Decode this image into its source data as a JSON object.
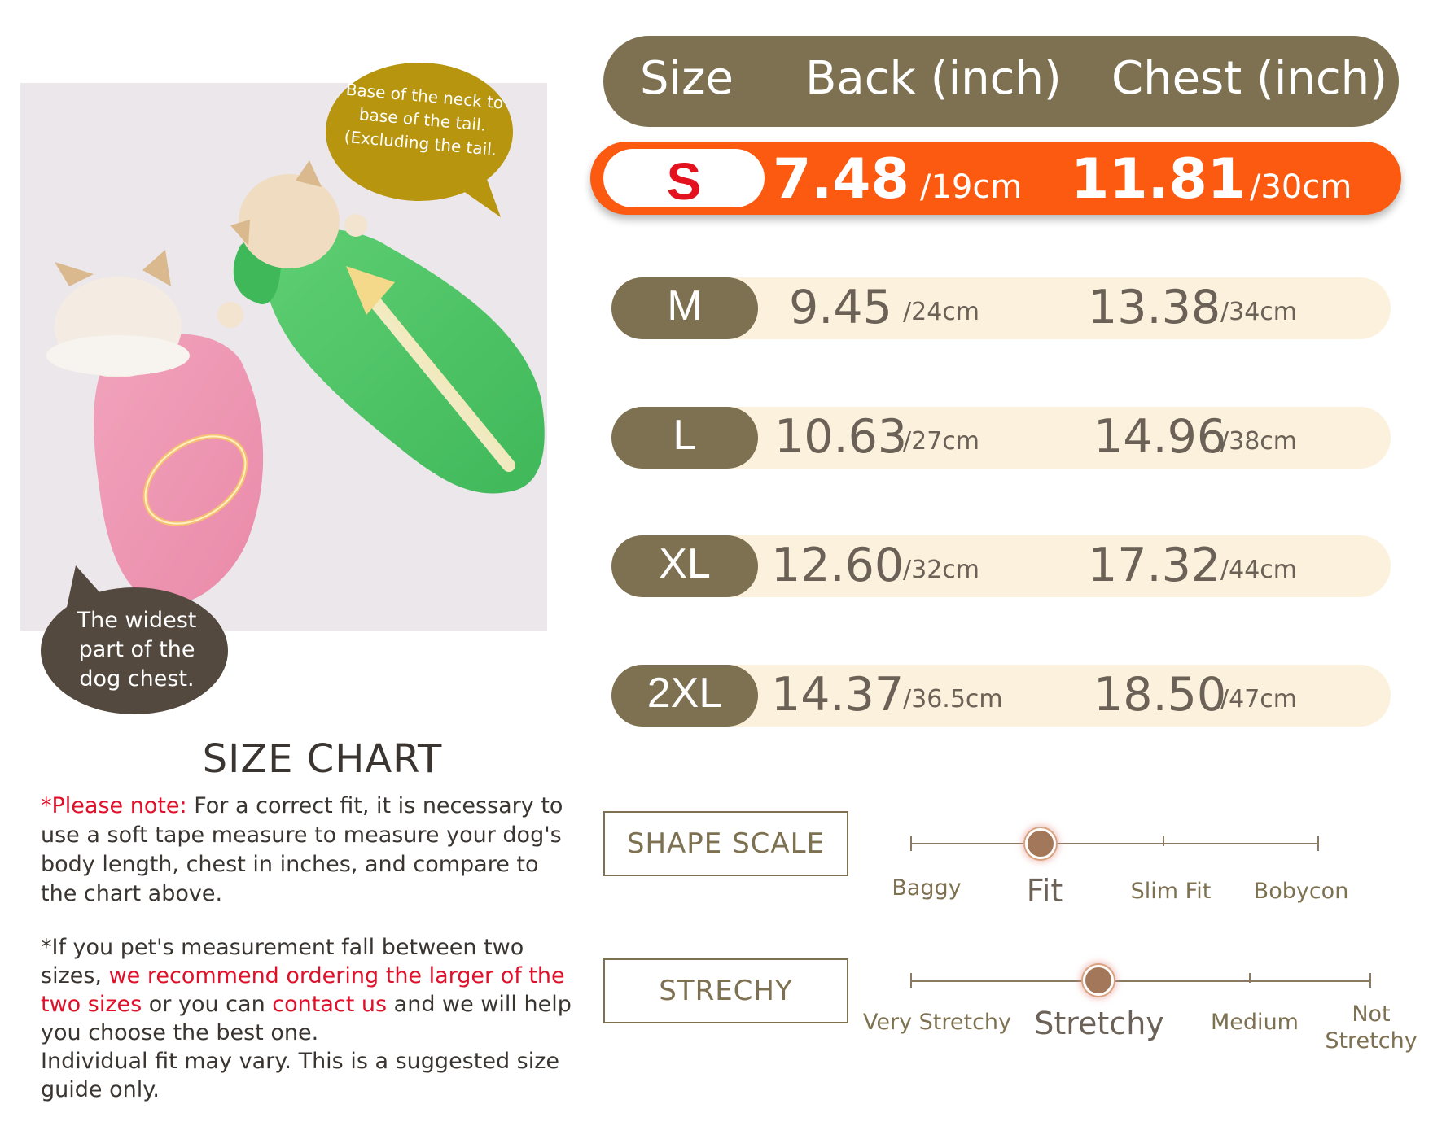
{
  "photo": {
    "callout_top": "Base of the neck to base of the tail. (Excluding the tail.",
    "callout_bottom": "The widest part of the dog chest."
  },
  "left": {
    "title": "SIZE CHART",
    "note_prefix": "*Please note:",
    "note_text": " For a correct fit, it is necessary to use a soft tape measure to measure your dog's body length, chest in inches, and compare to the chart above.",
    "tip_1": " *If you pet's measurement fall between two sizes, ",
    "tip_red_1": "we recommend ordering the larger of the two sizes",
    "tip_2": " or you can ",
    "tip_red_2": "contact us",
    "tip_3": " and we will help you choose the best one.",
    "disclaimer": "Individual fit may vary. This is a suggested size guide only."
  },
  "table": {
    "headers": {
      "size": "Size",
      "back": "Back (inch)",
      "chest": "Chest (inch)"
    },
    "rows": [
      {
        "size": "S",
        "back": "7.48",
        "back_cm": "/19cm",
        "chest": "11.81",
        "chest_cm": "/30cm",
        "highlighted": true
      },
      {
        "size": "M",
        "back": "9.45",
        "back_cm": "/24cm",
        "chest": "13.38",
        "chest_cm": "/34cm"
      },
      {
        "size": "L",
        "back": "10.63",
        "back_cm": "/27cm",
        "chest": "14.96",
        "chest_cm": "/38cm"
      },
      {
        "size": "XL",
        "back": "12.60",
        "back_cm": "/32cm",
        "chest": "17.32",
        "chest_cm": "/44cm"
      },
      {
        "size": "2XL",
        "back": "14.37",
        "back_cm": "/36.5cm",
        "chest": "18.50",
        "chest_cm": "/47cm"
      }
    ]
  },
  "shape_scale": {
    "label": "SHAPE SCALE",
    "options": [
      "Baggy",
      "Fit",
      "Slim Fit",
      "Bobycon"
    ],
    "selected": "Fit"
  },
  "stretch_scale": {
    "label": "STRECHY",
    "options": [
      "Very Stretchy",
      "Stretchy",
      "Medium",
      "Not Stretchy"
    ],
    "selected": "Stretchy"
  },
  "colors": {
    "olive": "#7d7151",
    "highlight": "#fb5a10",
    "row_bg": "#fbf1dd",
    "accent_red": "#e0102a"
  }
}
